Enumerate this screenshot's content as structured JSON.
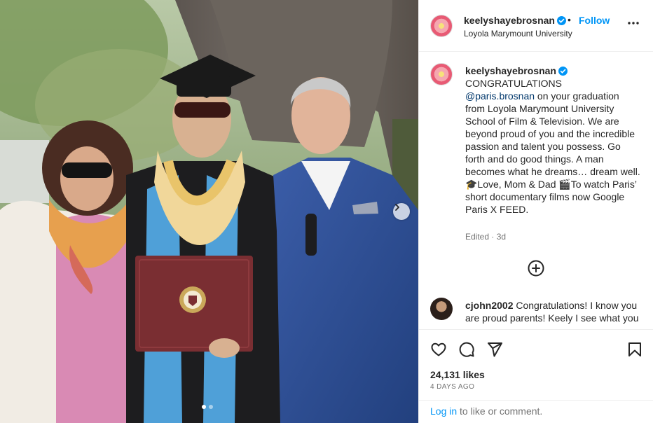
{
  "post": {
    "author": {
      "username": "keelyshayebrosnan",
      "verified": true,
      "avatar_icon": "flower-avatar-icon"
    },
    "header": {
      "separator": "•",
      "follow_label": "Follow",
      "location": "Loyola Marymount University"
    },
    "caption": {
      "text_before_mention": "CONGRATULATIONS",
      "mention": "@paris.brosnan",
      "text_after_mention": " on your graduation from Loyola Marymount University School of Film & Television. We are beyond proud of you and the incredible passion and talent you possess. Go forth and do good things. A man becomes what he dreams… dream well. 🎓Love, Mom & Dad 🎬To watch Paris’ short documentary films now Google Paris X FEED.",
      "edited": "Edited",
      "age": "3d"
    },
    "comments": [
      {
        "username": "cjohn2002",
        "text": "Congratulations! I know you are proud parents! Keely I see what you meant about the stress of graduation"
      }
    ],
    "likes_label": "24,131 likes",
    "posted_ago": "4 DAYS AGO",
    "login_prompt": {
      "link": "Log in",
      "rest": " to like or comment."
    },
    "carousel": {
      "current": 1,
      "total": 2
    }
  },
  "icons": {
    "more": "more-options-icon",
    "verified": "verified-badge-icon",
    "load_more": "plus-circle-icon",
    "like": "heart-icon",
    "comment": "comment-icon",
    "share": "send-icon",
    "save": "bookmark-icon",
    "next": "chevron-right-icon"
  },
  "colors": {
    "link_blue": "#0095f6",
    "mention": "#00376b",
    "secondary_text": "#737373",
    "border": "#efefef"
  }
}
